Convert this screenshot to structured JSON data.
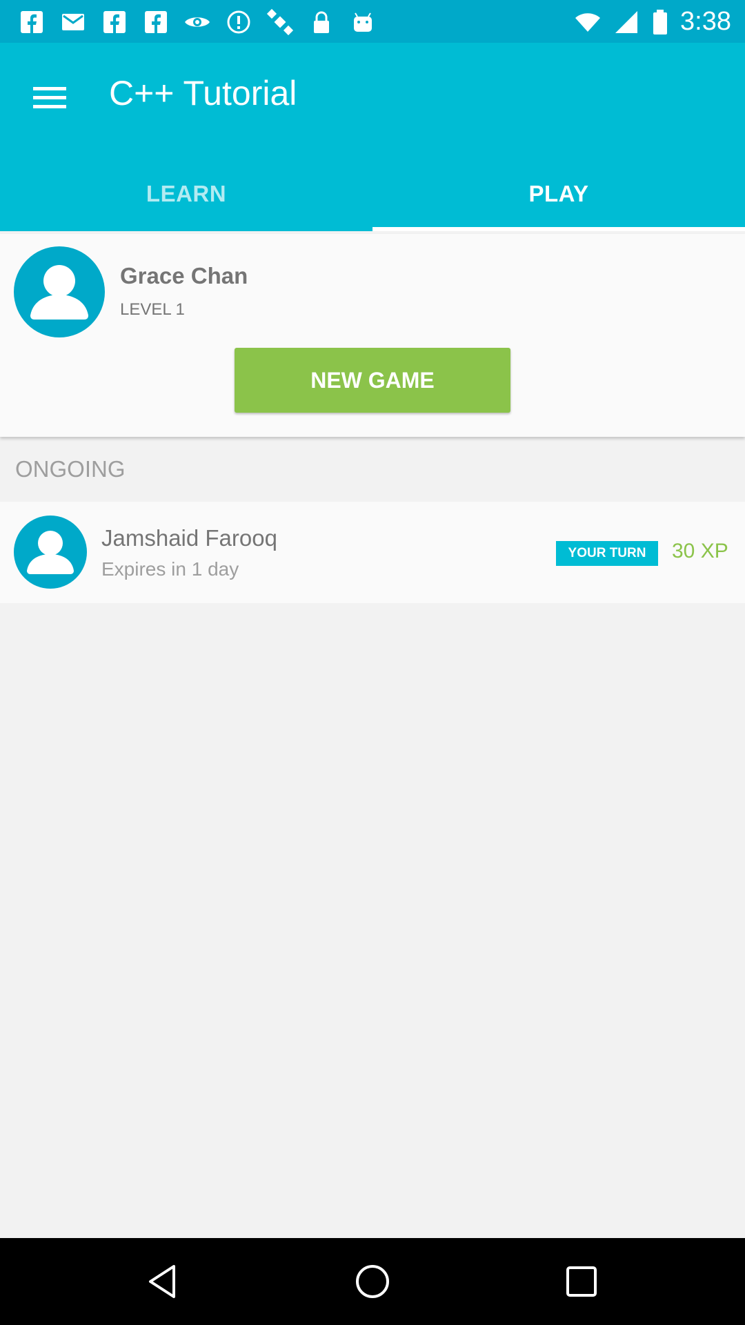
{
  "status_bar": {
    "time": "3:38",
    "icons": [
      "facebook-icon",
      "email-icon",
      "facebook-icon",
      "facebook-icon",
      "eye-icon",
      "alert-icon",
      "satellite-icon",
      "lock-icon",
      "android-icon"
    ],
    "right_icons": [
      "wifi-icon",
      "signal-icon",
      "battery-icon"
    ]
  },
  "app_bar": {
    "title": "C++ Tutorial",
    "menu_icon": "hamburger-menu-icon"
  },
  "tabs": [
    {
      "label": "LEARN",
      "active": false
    },
    {
      "label": "PLAY",
      "active": true
    }
  ],
  "profile": {
    "name": "Grace Chan",
    "level": "LEVEL 1",
    "avatar_icon": "user-avatar-icon",
    "new_game_label": "NEW GAME"
  },
  "ongoing": {
    "header": "ONGOING",
    "games": [
      {
        "opponent": "Jamshaid Farooq",
        "expires": "Expires in 1 day",
        "status": "YOUR TURN",
        "xp": "30 XP"
      }
    ]
  },
  "nav_bar": {
    "buttons": [
      "back-icon",
      "home-icon",
      "recents-icon"
    ]
  },
  "colors": {
    "primary": "#00bcd4",
    "primary_dark": "#00a9c9",
    "accent_green": "#8bc34a",
    "background": "#f2f2f2"
  }
}
